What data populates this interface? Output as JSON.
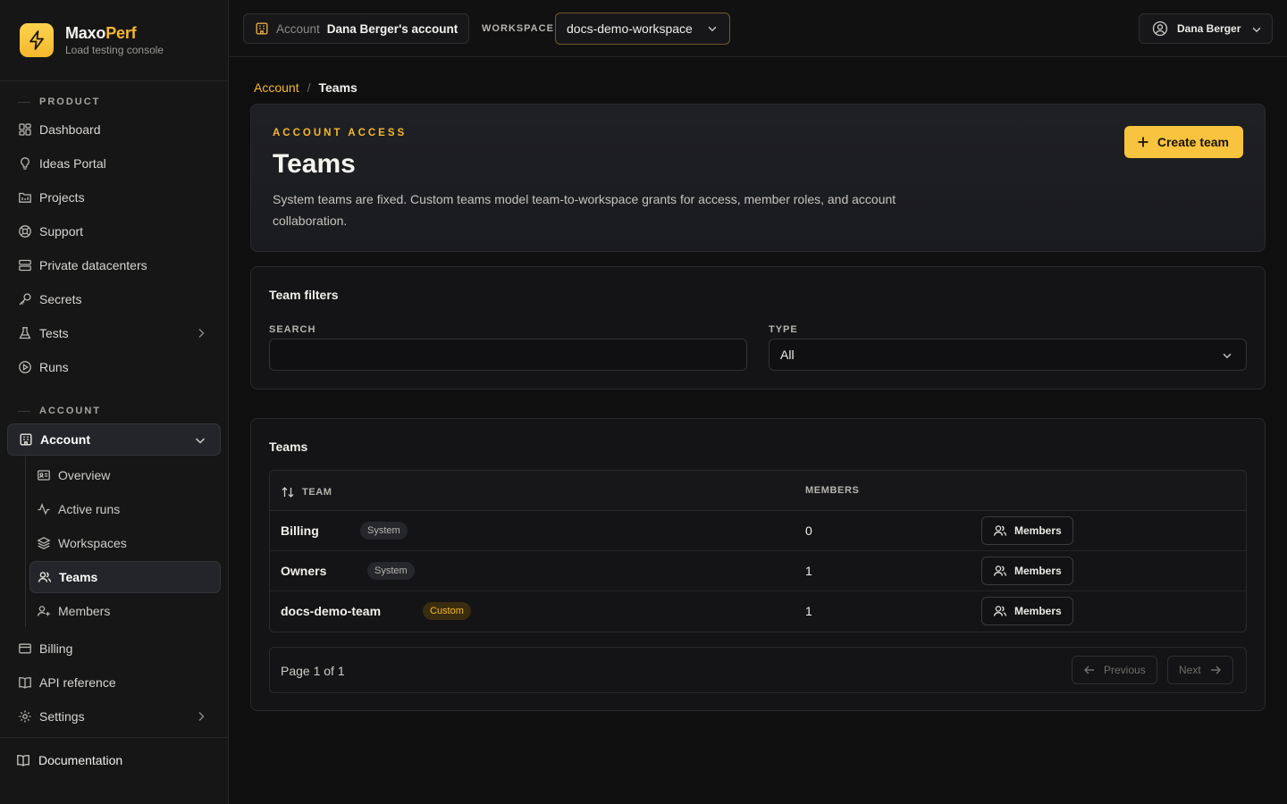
{
  "brand": {
    "name_main": "Maxo",
    "name_accent": "Perf",
    "subtitle": "Load testing console",
    "accent_color": "#f5b82e",
    "logo_icon": "bolt-icon"
  },
  "sidebar": {
    "product_label": "PRODUCT",
    "account_label": "ACCOUNT",
    "product_items": [
      {
        "label": "Dashboard",
        "icon": "grid-icon"
      },
      {
        "label": "Ideas Portal",
        "icon": "lightbulb-icon"
      },
      {
        "label": "Projects",
        "icon": "folder-icon"
      },
      {
        "label": "Support",
        "icon": "lifebuoy-icon"
      },
      {
        "label": "Private datacenters",
        "icon": "server-icon"
      },
      {
        "label": "Secrets",
        "icon": "key-icon"
      },
      {
        "label": "Tests",
        "icon": "flask-icon"
      },
      {
        "label": "Runs",
        "icon": "play-circle-icon"
      }
    ],
    "account_group": {
      "label": "Account",
      "icon": "building-icon",
      "expanded": true
    },
    "account_items": [
      {
        "label": "Overview",
        "icon": "id-card-icon"
      },
      {
        "label": "Active runs",
        "icon": "activity-icon"
      },
      {
        "label": "Workspaces",
        "icon": "layers-icon"
      },
      {
        "label": "Teams",
        "icon": "users-icon",
        "active": true
      },
      {
        "label": "Members",
        "icon": "user-plus-icon"
      }
    ],
    "other_items": [
      {
        "label": "Billing",
        "icon": "credit-card-icon"
      },
      {
        "label": "API reference",
        "icon": "book-icon"
      },
      {
        "label": "Settings",
        "icon": "gear-icon"
      }
    ],
    "footer_link": {
      "label": "Documentation",
      "icon": "book-open-icon"
    }
  },
  "topbar": {
    "account_label": "Account",
    "account_value": "Dana Berger's account",
    "workspace_label": "WORKSPACE",
    "workspace_value": "docs-demo-workspace",
    "user_name": "Dana Berger"
  },
  "breadcrumb": {
    "parent": "Account",
    "sep": "/",
    "current": "Teams"
  },
  "hero": {
    "eyebrow": "ACCOUNT ACCESS",
    "title": "Teams",
    "description": "System teams are fixed. Custom teams model team-to-workspace grants for access, member roles, and account collaboration.",
    "create_button": "Create team"
  },
  "filters": {
    "title": "Team filters",
    "search_label": "SEARCH",
    "search_value": "",
    "type_label": "TYPE",
    "type_value": "All"
  },
  "teams_table": {
    "title": "Teams",
    "columns": {
      "team": "TEAM",
      "members": "MEMBERS"
    },
    "rows": [
      {
        "name": "Billing",
        "type": "System",
        "members": "0",
        "action": "Members"
      },
      {
        "name": "Owners",
        "type": "System",
        "members": "1",
        "action": "Members"
      },
      {
        "name": "docs-demo-team",
        "type": "Custom",
        "members": "1",
        "action": "Members"
      }
    ]
  },
  "pagination": {
    "text": "Page 1 of 1",
    "previous": "Previous",
    "next": "Next"
  }
}
